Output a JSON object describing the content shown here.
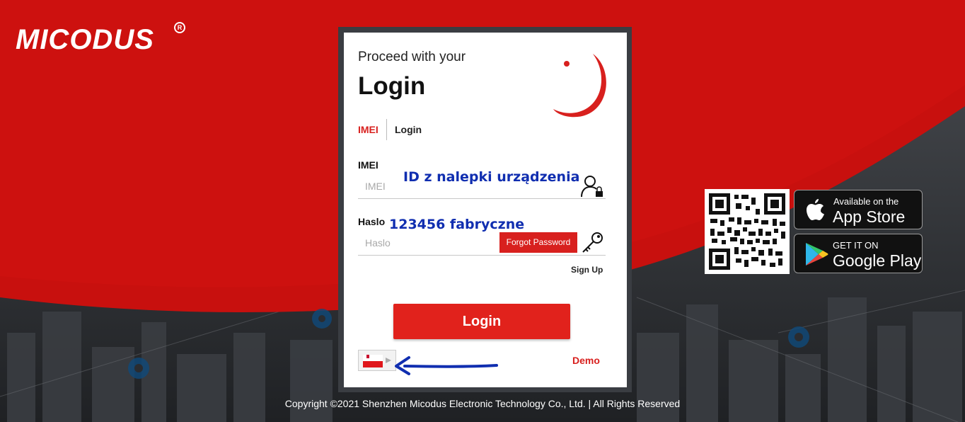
{
  "brand": {
    "logo_text": "MICODUS",
    "registered_mark": "R"
  },
  "login_card": {
    "subtitle": "Proceed with your",
    "title": "Login",
    "tabs": [
      "IMEI",
      "Login"
    ],
    "imei_label": "IMEI",
    "imei_placeholder": "IMEI",
    "imei_note": "ID z nalepki urządzenia",
    "password_label": "Haslo",
    "password_placeholder": "Haslo",
    "password_note": "123456 fabryczne",
    "forgot_password": "Forgot Password",
    "sign_up": "Sign Up",
    "login_button": "Login",
    "demo": "Demo",
    "language_flag": "poland-flag-icon"
  },
  "apps": {
    "qr_icon": "qr-code-icon",
    "app_store": {
      "top": "Available on the",
      "bottom": "App Store",
      "icon": "apple-icon"
    },
    "google_play": {
      "top": "GET IT ON",
      "bottom": "Google Play",
      "icon": "google-play-icon"
    }
  },
  "footer": {
    "copyright": "Copyright ©2021 Shenzhen Micodus Electronic Technology Co., Ltd. | All Rights Reserved"
  },
  "colors": {
    "brand_red": "#d8201e",
    "note_blue": "#102eb0",
    "dark_bg": "#2a2c30"
  }
}
